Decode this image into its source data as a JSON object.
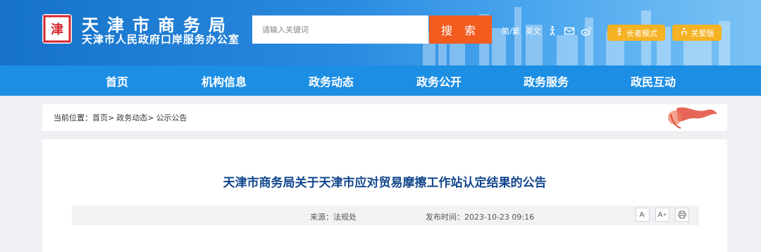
{
  "header": {
    "logo_glyph": "津",
    "title": "天津市商务局",
    "subtitle": "天津市人民政府口岸服务办公室",
    "search_placeholder": "请输入关键词",
    "search_button": "搜 索",
    "tool_lang_trad": "简/繁",
    "tool_lang_en": "英文",
    "elder_mode": "长者模式",
    "care_version": "关爱版",
    "colors": {
      "primary": "#1c8ee4",
      "search_btn": "#f25c1f",
      "pill": "#f5b223",
      "title_text": "#13478c"
    }
  },
  "nav": {
    "items": [
      {
        "label": "首页"
      },
      {
        "label": "机构信息"
      },
      {
        "label": "政务动态"
      },
      {
        "label": "政务公开"
      },
      {
        "label": "政务服务"
      },
      {
        "label": "政民互动"
      }
    ]
  },
  "breadcrumb": {
    "prefix": "当前位置：",
    "items": [
      "首页",
      "政务动态",
      "公示公告"
    ],
    "sep": ">"
  },
  "article": {
    "title": "天津市商务局关于天津市应对贸易摩擦工作站认定结果的公告",
    "source": "来源：法规处",
    "published": "发布时间：2023-10-23 09:16",
    "font_smaller": "A",
    "font_larger": "A"
  }
}
